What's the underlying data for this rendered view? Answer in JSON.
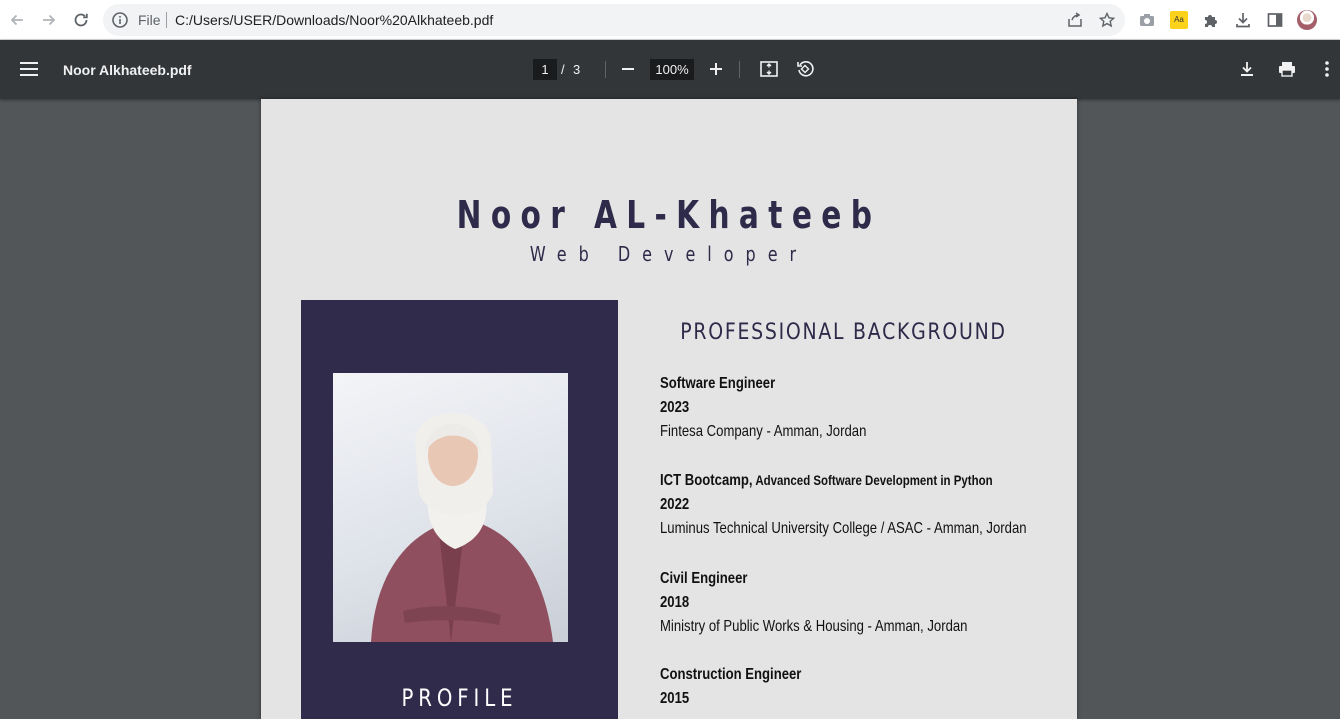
{
  "browser": {
    "file_label": "File",
    "url": "C:/Users/USER/Downloads/Noor%20Alkhateeb.pdf",
    "translate_badge": "Aa"
  },
  "viewer": {
    "title": "Noor Alkhateeb.pdf",
    "page_current": "1",
    "page_separator": "/",
    "page_total": "3",
    "zoom": "100%"
  },
  "document": {
    "name": "Noor AL-Khateeb",
    "role": "Web Developer",
    "profile_heading": "PROFILE",
    "section_heading": "PROFESSIONAL BACKGROUND",
    "jobs": [
      {
        "title": "Software Engineer",
        "title_sub": "",
        "year": "2023",
        "place": "Fintesa Company - Amman, Jordan"
      },
      {
        "title": "ICT Bootcamp,",
        "title_sub": " Advanced Software Development in Python",
        "year": "2022",
        "place": "Luminus Technical University College / ASAC - Amman, Jordan"
      },
      {
        "title": "Civil Engineer",
        "title_sub": "",
        "year": "2018",
        "place": "Ministry of Public Works & Housing - Amman, Jordan"
      },
      {
        "title": "Construction Engineer",
        "title_sub": "",
        "year": "2015",
        "place": ""
      }
    ]
  },
  "colors": {
    "viewer_toolbar": "#323639",
    "viewer_background": "#525659",
    "page_background": "#e5e4e4",
    "accent_navy": "#312b4b",
    "heading_text": "#2d2a4a"
  }
}
